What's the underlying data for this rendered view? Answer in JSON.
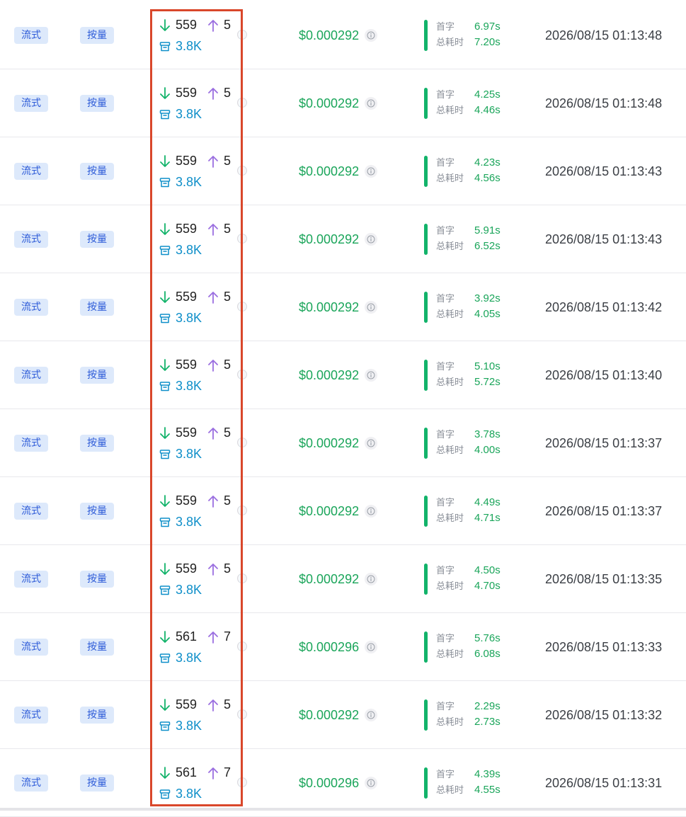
{
  "rows": [
    {
      "mode": "流式",
      "billing": "按量",
      "input_tokens": "559",
      "output_tokens": "5",
      "cache_tokens": "3.8K",
      "cost": "$0.000292",
      "first_token_label": "首字",
      "first_token": "6.97s",
      "total_label": "总耗时",
      "total": "7.20s",
      "time": "2026/08/15 01:13:48"
    },
    {
      "mode": "流式",
      "billing": "按量",
      "input_tokens": "559",
      "output_tokens": "5",
      "cache_tokens": "3.8K",
      "cost": "$0.000292",
      "first_token_label": "首字",
      "first_token": "4.25s",
      "total_label": "总耗时",
      "total": "4.46s",
      "time": "2026/08/15 01:13:48"
    },
    {
      "mode": "流式",
      "billing": "按量",
      "input_tokens": "559",
      "output_tokens": "5",
      "cache_tokens": "3.8K",
      "cost": "$0.000292",
      "first_token_label": "首字",
      "first_token": "4.23s",
      "total_label": "总耗时",
      "total": "4.56s",
      "time": "2026/08/15 01:13:43"
    },
    {
      "mode": "流式",
      "billing": "按量",
      "input_tokens": "559",
      "output_tokens": "5",
      "cache_tokens": "3.8K",
      "cost": "$0.000292",
      "first_token_label": "首字",
      "first_token": "5.91s",
      "total_label": "总耗时",
      "total": "6.52s",
      "time": "2026/08/15 01:13:43"
    },
    {
      "mode": "流式",
      "billing": "按量",
      "input_tokens": "559",
      "output_tokens": "5",
      "cache_tokens": "3.8K",
      "cost": "$0.000292",
      "first_token_label": "首字",
      "first_token": "3.92s",
      "total_label": "总耗时",
      "total": "4.05s",
      "time": "2026/08/15 01:13:42"
    },
    {
      "mode": "流式",
      "billing": "按量",
      "input_tokens": "559",
      "output_tokens": "5",
      "cache_tokens": "3.8K",
      "cost": "$0.000292",
      "first_token_label": "首字",
      "first_token": "5.10s",
      "total_label": "总耗时",
      "total": "5.72s",
      "time": "2026/08/15 01:13:40"
    },
    {
      "mode": "流式",
      "billing": "按量",
      "input_tokens": "559",
      "output_tokens": "5",
      "cache_tokens": "3.8K",
      "cost": "$0.000292",
      "first_token_label": "首字",
      "first_token": "3.78s",
      "total_label": "总耗时",
      "total": "4.00s",
      "time": "2026/08/15 01:13:37"
    },
    {
      "mode": "流式",
      "billing": "按量",
      "input_tokens": "559",
      "output_tokens": "5",
      "cache_tokens": "3.8K",
      "cost": "$0.000292",
      "first_token_label": "首字",
      "first_token": "4.49s",
      "total_label": "总耗时",
      "total": "4.71s",
      "time": "2026/08/15 01:13:37"
    },
    {
      "mode": "流式",
      "billing": "按量",
      "input_tokens": "559",
      "output_tokens": "5",
      "cache_tokens": "3.8K",
      "cost": "$0.000292",
      "first_token_label": "首字",
      "first_token": "4.50s",
      "total_label": "总耗时",
      "total": "4.70s",
      "time": "2026/08/15 01:13:35"
    },
    {
      "mode": "流式",
      "billing": "按量",
      "input_tokens": "561",
      "output_tokens": "7",
      "cache_tokens": "3.8K",
      "cost": "$0.000296",
      "first_token_label": "首字",
      "first_token": "5.76s",
      "total_label": "总耗时",
      "total": "6.08s",
      "time": "2026/08/15 01:13:33"
    },
    {
      "mode": "流式",
      "billing": "按量",
      "input_tokens": "559",
      "output_tokens": "5",
      "cache_tokens": "3.8K",
      "cost": "$0.000292",
      "first_token_label": "首字",
      "first_token": "2.29s",
      "total_label": "总耗时",
      "total": "2.73s",
      "time": "2026/08/15 01:13:32"
    },
    {
      "mode": "流式",
      "billing": "按量",
      "input_tokens": "561",
      "output_tokens": "7",
      "cache_tokens": "3.8K",
      "cost": "$0.000296",
      "first_token_label": "首字",
      "first_token": "4.39s",
      "total_label": "总耗时",
      "total": "4.55s",
      "time": "2026/08/15 01:13:31"
    }
  ],
  "icons": {
    "input": "arrow-down-icon",
    "output": "arrow-up-icon",
    "cache": "archive-box-icon",
    "info": "info-circle-icon"
  },
  "colors": {
    "tag_bg": "#dde9fb",
    "tag_text": "#2d5bd8",
    "input_arrow": "#12b36a",
    "output_arrow": "#9a6ee0",
    "cache": "#0f8fc9",
    "cost": "#1aa55a",
    "timing_bar": "#12b36a",
    "highlight_border": "#d9472b"
  }
}
